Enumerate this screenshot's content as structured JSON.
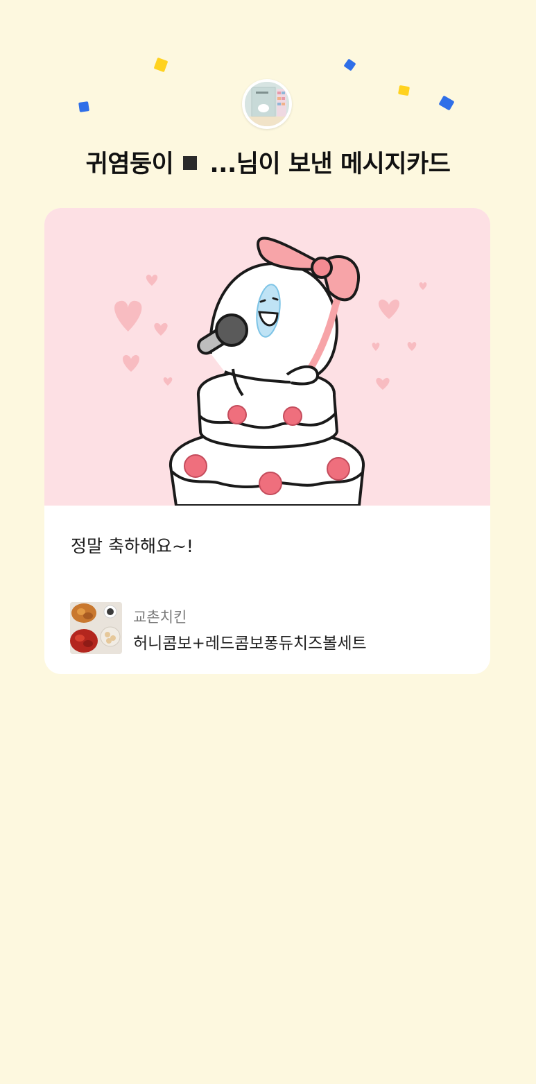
{
  "header": {
    "sender_prefix": "귀염둥이",
    "sender_suffix": "...님이 보낸 메시지카드"
  },
  "card": {
    "message": "정말 축하해요~!"
  },
  "gift": {
    "brand": "교촌치킨",
    "product_name": "허니콤보+레드콤보퐁듀치즈볼세트"
  },
  "colors": {
    "background": "#fdf8df",
    "card_image_background": "#fde0e4",
    "confetti_yellow": "#ffd21f",
    "confetti_blue": "#2f6fe8",
    "bow_pink": "#f7a4a8"
  },
  "icons": {
    "profile": "profile-avatar",
    "card_art": "singing-character-on-cake",
    "thumbnail": "chicken-set-thumbnail"
  }
}
